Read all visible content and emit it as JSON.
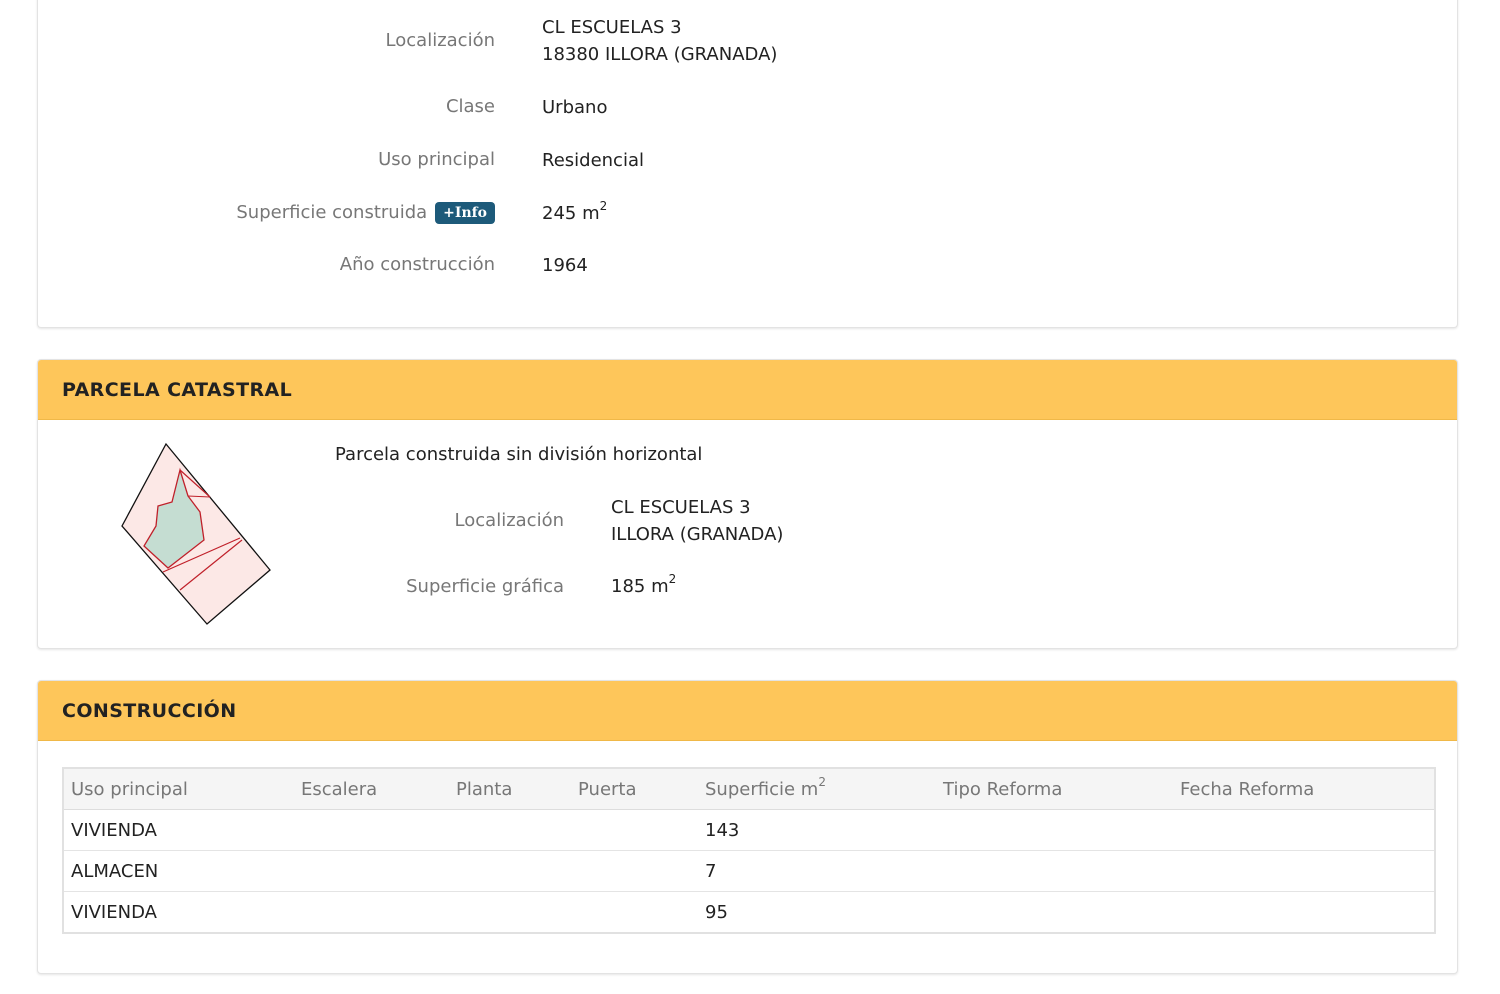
{
  "inmueble": {
    "localizacion_label": "Localización",
    "localizacion_line1": "CL ESCUELAS 3",
    "localizacion_line2": "18380 ILLORA (GRANADA)",
    "clase_label": "Clase",
    "clase_value": "Urbano",
    "uso_label": "Uso principal",
    "uso_value": "Residencial",
    "superficie_label": "Superficie construida",
    "info_badge": "+Info",
    "superficie_value": "245 m",
    "superficie_sup": "2",
    "anio_label": "Año construcción",
    "anio_value": "1964"
  },
  "parcela": {
    "heading": "PARCELA CATASTRAL",
    "description": "Parcela construida sin división horizontal",
    "localizacion_label": "Localización",
    "localizacion_line1": "CL ESCUELAS 3",
    "localizacion_line2": "ILLORA (GRANADA)",
    "superficie_label": "Superficie gráfica",
    "superficie_value": "185 m",
    "superficie_sup": "2",
    "map_icon": "parcel-map-thumbnail",
    "colors": {
      "parcel_fill": "#fce8e6",
      "parcel_stroke": "#c0202a",
      "building_fill": "#c5ddd2",
      "outline": "#111111"
    }
  },
  "construccion": {
    "heading": "CONSTRUCCIÓN",
    "columns": [
      "Uso principal",
      "Escalera",
      "Planta",
      "Puerta",
      "Superficie m",
      "Tipo Reforma",
      "Fecha Reforma"
    ],
    "superficie_sup": "2",
    "rows": [
      {
        "uso": "VIVIENDA",
        "escalera": "",
        "planta": "",
        "puerta": "",
        "superficie": "143",
        "tipo_reforma": "",
        "fecha_reforma": ""
      },
      {
        "uso": "ALMACEN",
        "escalera": "",
        "planta": "",
        "puerta": "",
        "superficie": "7",
        "tipo_reforma": "",
        "fecha_reforma": ""
      },
      {
        "uso": "VIVIENDA",
        "escalera": "",
        "planta": "",
        "puerta": "",
        "superficie": "95",
        "tipo_reforma": "",
        "fecha_reforma": ""
      }
    ]
  },
  "theme": {
    "heading_bg": "#fec65a",
    "badge_bg": "#1d5a7a"
  }
}
